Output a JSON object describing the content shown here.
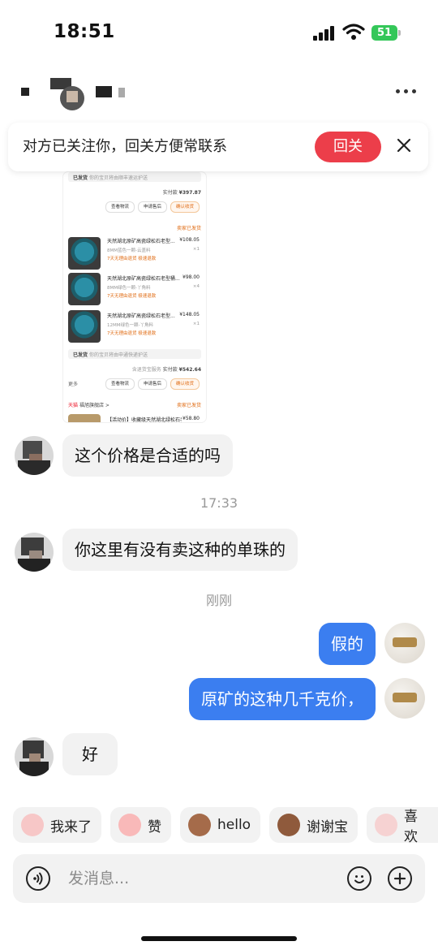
{
  "status_bar": {
    "time": "18:51",
    "battery": "51"
  },
  "header": {
    "more_icon": "more-dots-icon"
  },
  "banner": {
    "text": "对方已关注你，回关方便常联系",
    "follow_back_label": "回关",
    "close_icon": "close-icon"
  },
  "screenshot": {
    "shipped1": "已发货",
    "shipped1_note": "你的宝贝将由顺丰速运护送",
    "paid1_label": "实付款",
    "paid1_value": "¥397.87",
    "btn_logistics": "查看物流",
    "btn_aftersale": "申请售后",
    "btn_confirm": "确认收货",
    "seller_shipped": "卖家已发货",
    "products": [
      {
        "title": "天然湖北原矿高瓷绿松石老型...",
        "sub": "8MM蓝色一颗-云盖料",
        "tag": "7天无理由退货  极速退款",
        "price": "¥108.05",
        "count": "×1"
      },
      {
        "title": "天然湖北原矿高瓷绿松石老型桶...",
        "sub": "8MM绿色一颗-丫角料",
        "tag": "7天无理由退货  极速退款",
        "price": "¥98.00",
        "count": "×4"
      },
      {
        "title": "天然湖北原矿高瓷绿松石老型...",
        "sub": "12MM绿色一颗-丫角料",
        "tag": "7天无理由退货  极速退款",
        "price": "¥148.05",
        "count": "×1"
      }
    ],
    "shipped2": "已发货",
    "shipped2_note": "你的宝贝将由申通快递护送",
    "service_note": "含退货宝服务",
    "paid2_label": "实付款",
    "paid2_value": "¥542.64",
    "more_label": "更多",
    "tmall": "天猫",
    "store_name": "福旭旗舰店 >",
    "seller_shipped2": "卖家已发货",
    "last_title": "【活动价】收藏级天然湖北绿松石手串...",
    "last_price": "¥58.80"
  },
  "messages": [
    {
      "from": "other",
      "text": "这个价格是合适的吗"
    },
    {
      "time": "17:33"
    },
    {
      "from": "other",
      "text": "你这里有没有卖这种的单珠的"
    },
    {
      "time": "刚刚"
    },
    {
      "from": "self",
      "text": "假的"
    },
    {
      "from": "self",
      "text": "原矿的这种几千克价，"
    },
    {
      "from": "other",
      "text": "好"
    }
  ],
  "quick_replies": [
    {
      "label": "我来了",
      "icon": "pig-sticker-icon"
    },
    {
      "label": "赞",
      "icon": "pig-thumbs-sticker-icon"
    },
    {
      "label": "hello",
      "icon": "monkey-sticker-icon"
    },
    {
      "label": "谢谢宝",
      "icon": "monkey-thanks-sticker-icon"
    },
    {
      "label": "喜欢",
      "icon": "pig-love-sticker-icon"
    }
  ],
  "input": {
    "placeholder": "发消息...",
    "voice_icon": "voice-icon",
    "emoji_icon": "emoji-icon",
    "plus_icon": "plus-icon"
  },
  "colors": {
    "accent_blue": "#3b7ef0",
    "follow_red": "#ec3e4a",
    "battery_green": "#34c759"
  }
}
